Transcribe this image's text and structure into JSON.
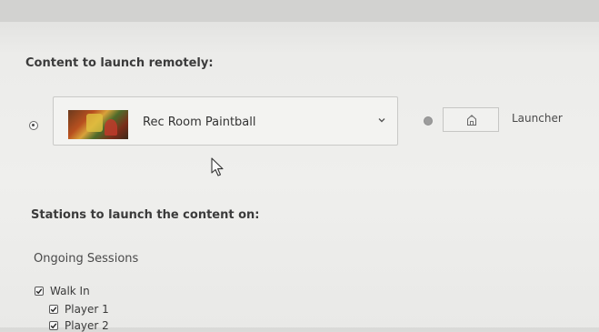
{
  "launch": {
    "heading": "Content to launch remotely:",
    "content_select": {
      "selected_label": "Rec Room Paintball",
      "selected": true,
      "thumbnail_icon": "rec-room-paintball-thumbnail"
    },
    "launcher_option": {
      "label": "Launcher",
      "selected": false,
      "icon": "home-icon"
    }
  },
  "stations": {
    "heading": "Stations to launch the content on:",
    "ongoing_label": "Ongoing Sessions",
    "items": [
      {
        "label": "Walk In",
        "checked": true
      },
      {
        "label": "Player 1",
        "checked": true
      },
      {
        "label": "Player 2",
        "checked": true
      }
    ]
  },
  "colors": {
    "background": "#efefed",
    "text": "#3a3a3a"
  }
}
